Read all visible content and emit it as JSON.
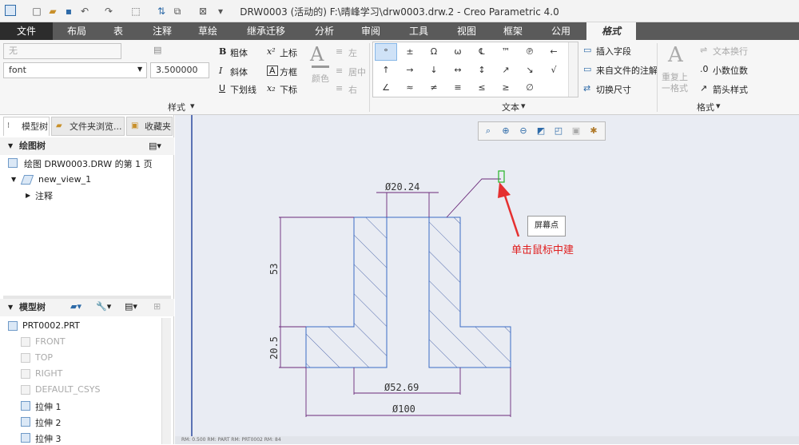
{
  "window": {
    "title": "DRW0003 (活动的) F:\\晴峰学习\\drw0003.drw.2 - Creo Parametric 4.0"
  },
  "tabs": [
    "文件",
    "布局",
    "表",
    "注释",
    "草绘",
    "继承迁移",
    "分析",
    "审阅",
    "工具",
    "视图",
    "框架",
    "公用",
    "格式"
  ],
  "ribbon": {
    "style_select": "无",
    "font_select": "font",
    "height_value": "3.500000",
    "bold": "粗体",
    "italic": "斜体",
    "underline": "下划线",
    "superscript": "上标",
    "box": "方框",
    "subscript": "下标",
    "color": "颜色",
    "align_left": "左",
    "align_center": "居中",
    "align_right": "右",
    "style_group": "样式",
    "text_group": "文本",
    "format_group": "格式",
    "insert_field": "插入字段",
    "note_from_file": "来自文件的注解",
    "toggle_dim": "切换尺寸",
    "repeat_last_format": "重复上一格式",
    "text_wrap": "文本换行",
    "decimal_places": "小数位数",
    "arrow_style": "箭头样式",
    "symbols": [
      "°",
      "±",
      "Ω",
      "ω",
      "℄",
      "™",
      "℗",
      "←",
      "↑",
      "→",
      "↓",
      "↔",
      "↕",
      "↗",
      "↘",
      "√",
      "∠",
      "≈",
      "≠",
      "≡",
      "≤",
      "≥",
      "∅"
    ]
  },
  "left_panel": {
    "tabs": [
      "模型树",
      "文件夹浏览...",
      "收藏夹"
    ],
    "drawing_tree_title": "绘图树",
    "drawing_items": [
      "绘图 DRW0003.DRW 的第 1 页",
      "new_view_1",
      "注释"
    ],
    "model_tree_title": "模型树",
    "model_items": [
      "PRT0002.PRT",
      "FRONT",
      "TOP",
      "RIGHT",
      "DEFAULT_CSYS",
      "拉伸 1",
      "拉伸 2",
      "拉伸 3"
    ]
  },
  "drawing": {
    "dim_top": "Ø20.24",
    "dim_left_top": "53",
    "dim_left_bottom": "20.5",
    "dim_mid": "Ø52.69",
    "dim_bottom": "Ø100"
  },
  "tooltip": "屏幕点",
  "annotation": "单击鼠标中建",
  "status": "RM: 0.500   RM: PART   RM: PRT0002   RM: 84"
}
